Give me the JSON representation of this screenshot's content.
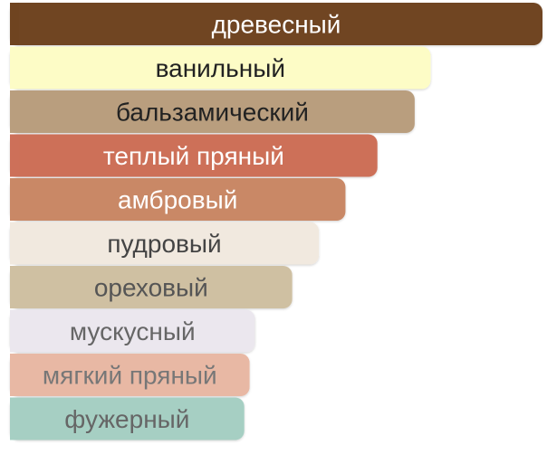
{
  "chart_data": {
    "type": "bar",
    "orientation": "horizontal",
    "title": "",
    "xlabel": "",
    "ylabel": "",
    "xlim": [
      0,
      100
    ],
    "grid": false,
    "legend": "none",
    "categories": [
      "древесный",
      "ванильный",
      "бальзамический",
      "теплый пряный",
      "амбровый",
      "пудровый",
      "ореховый",
      "мускусный",
      "мягкий пряный",
      "фужерный"
    ],
    "values": [
      100,
      79,
      76,
      69,
      63,
      58,
      53,
      46,
      45,
      44
    ],
    "colors": [
      "#6f4420",
      "#fdfcc6",
      "#b99e7e",
      "#cd7059",
      "#c98866",
      "#f1e9df",
      "#cfc0a2",
      "#ebe7ee",
      "#e8b8a4",
      "#a6cfc3"
    ],
    "label_colors": [
      "#ffffff",
      "#222222",
      "#222222",
      "#ffffff",
      "#ffffff",
      "#444444",
      "#555555",
      "#666666",
      "#777777",
      "#666666"
    ]
  }
}
